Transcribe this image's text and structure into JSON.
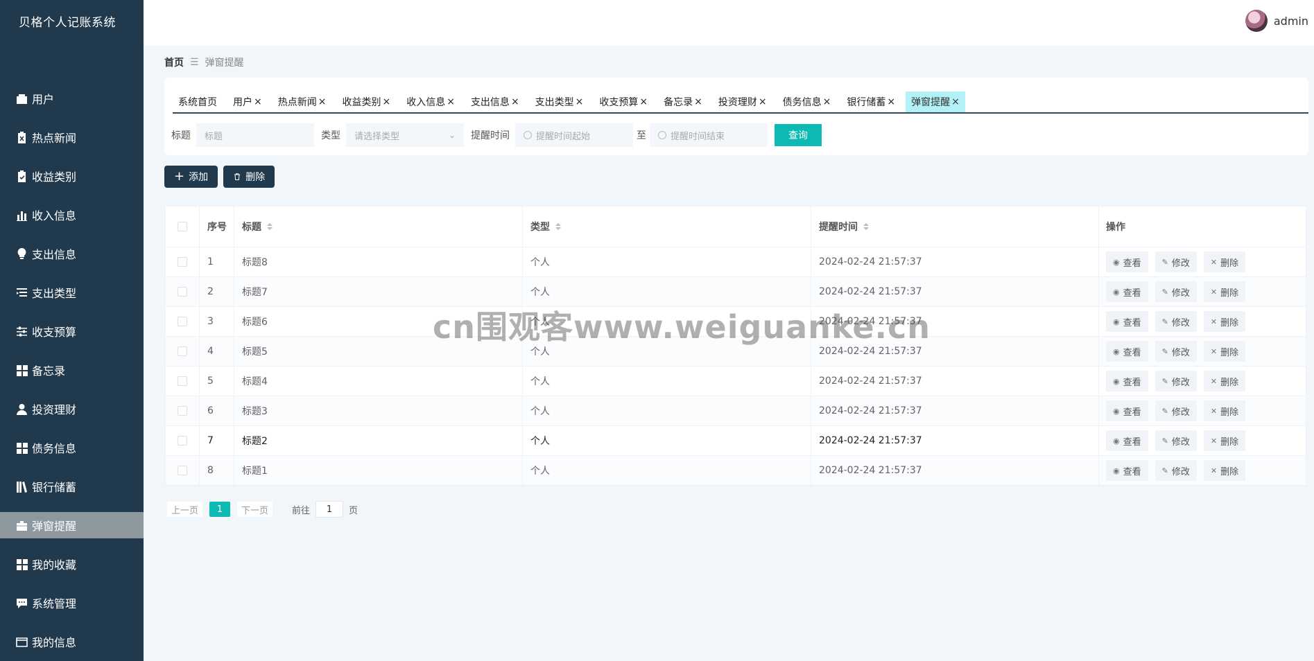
{
  "app": {
    "brand": "贝格个人记账系统"
  },
  "sidebar": {
    "items": [
      {
        "label": "用户",
        "icon": "user-card-icon"
      },
      {
        "label": "热点新闻",
        "icon": "news-clipboard-icon"
      },
      {
        "label": "收益类别",
        "icon": "clipboard-check-icon"
      },
      {
        "label": "收入信息",
        "icon": "bar-chart-icon"
      },
      {
        "label": "支出信息",
        "icon": "lightbulb-icon"
      },
      {
        "label": "支出类型",
        "icon": "list-indent-icon"
      },
      {
        "label": "收支预算",
        "icon": "sliders-icon"
      },
      {
        "label": "备忘录",
        "icon": "grid-icon"
      },
      {
        "label": "投资理财",
        "icon": "person-icon"
      },
      {
        "label": "债务信息",
        "icon": "grid-icon"
      },
      {
        "label": "银行储蓄",
        "icon": "books-icon"
      },
      {
        "label": "弹窗提醒",
        "icon": "briefcase-icon",
        "active": true
      },
      {
        "label": "我的收藏",
        "icon": "grid-icon"
      },
      {
        "label": "系统管理",
        "icon": "chat-icon"
      },
      {
        "label": "我的信息",
        "icon": "wallet-icon"
      }
    ]
  },
  "header": {
    "username": "admin"
  },
  "breadcrumb": {
    "home": "首页",
    "separator": "☰",
    "current": "弹窗提醒"
  },
  "tabs": [
    {
      "label": "系统首页",
      "closable": false
    },
    {
      "label": "用户",
      "closable": true
    },
    {
      "label": "热点新闻",
      "closable": true
    },
    {
      "label": "收益类别",
      "closable": true
    },
    {
      "label": "收入信息",
      "closable": true
    },
    {
      "label": "支出信息",
      "closable": true
    },
    {
      "label": "支出类型",
      "closable": true
    },
    {
      "label": "收支预算",
      "closable": true
    },
    {
      "label": "备忘录",
      "closable": true
    },
    {
      "label": "投资理财",
      "closable": true
    },
    {
      "label": "债务信息",
      "closable": true
    },
    {
      "label": "银行储蓄",
      "closable": true
    },
    {
      "label": "弹窗提醒",
      "closable": true,
      "active": true
    }
  ],
  "search": {
    "title_label": "标题",
    "title_placeholder": "标题",
    "type_label": "类型",
    "type_placeholder": "请选择类型",
    "time_label": "提醒时间",
    "time_start_placeholder": "提醒时间起始",
    "time_to": "至",
    "time_end_placeholder": "提醒时间结束",
    "query_button": "查询"
  },
  "actions": {
    "add": "添加",
    "delete": "删除"
  },
  "table": {
    "headers": {
      "index": "序号",
      "title": "标题",
      "type": "类型",
      "time": "提醒时间",
      "ops": "操作"
    },
    "rows": [
      {
        "index": "1",
        "title": "标题8",
        "type": "个人",
        "time": "2024-02-24 21:57:37"
      },
      {
        "index": "2",
        "title": "标题7",
        "type": "个人",
        "time": "2024-02-24 21:57:37"
      },
      {
        "index": "3",
        "title": "标题6",
        "type": "个人",
        "time": "2024-02-24 21:57:37"
      },
      {
        "index": "4",
        "title": "标题5",
        "type": "个人",
        "time": "2024-02-24 21:57:37"
      },
      {
        "index": "5",
        "title": "标题4",
        "type": "个人",
        "time": "2024-02-24 21:57:37"
      },
      {
        "index": "6",
        "title": "标题3",
        "type": "个人",
        "time": "2024-02-24 21:57:37"
      },
      {
        "index": "7",
        "title": "标题2",
        "type": "个人",
        "time": "2024-02-24 21:57:37"
      },
      {
        "index": "8",
        "title": "标题1",
        "type": "个人",
        "time": "2024-02-24 21:57:37"
      }
    ],
    "row_actions": {
      "view": "查看",
      "edit": "修改",
      "delete": "删除"
    }
  },
  "pagination": {
    "prev": "上一页",
    "current": "1",
    "next": "下一页",
    "goto_label": "前往",
    "goto_value": "1",
    "goto_unit": "页"
  },
  "watermark": "cn围观客www.weiguanke.cn",
  "colors": {
    "sidebar": "#21394c",
    "accent": "#0dbab3",
    "active_tab": "#b3f1f8"
  }
}
